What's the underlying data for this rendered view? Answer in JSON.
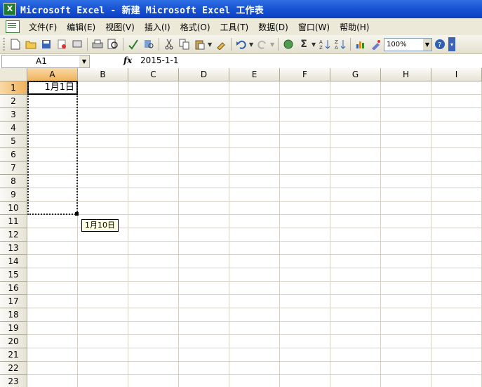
{
  "window": {
    "title": "Microsoft Excel - 新建 Microsoft Excel 工作表",
    "app_icon": "X"
  },
  "menu": {
    "items": [
      "文件(F)",
      "编辑(E)",
      "视图(V)",
      "插入(I)",
      "格式(O)",
      "工具(T)",
      "数据(D)",
      "窗口(W)",
      "帮助(H)"
    ]
  },
  "toolbar": {
    "zoom": "100%"
  },
  "formula_bar": {
    "name_box": "A1",
    "fx_label": "fx",
    "formula": "2015-1-1"
  },
  "sheet": {
    "columns": [
      "A",
      "B",
      "C",
      "D",
      "E",
      "F",
      "G",
      "H",
      "I"
    ],
    "rows": [
      "1",
      "2",
      "3",
      "4",
      "5",
      "6",
      "7",
      "8",
      "9",
      "10",
      "11",
      "12",
      "13",
      "14",
      "15",
      "16",
      "17",
      "18",
      "19",
      "20",
      "21",
      "22",
      "23"
    ],
    "a1_value": "1月1日",
    "fill_tooltip": "1月10日"
  }
}
